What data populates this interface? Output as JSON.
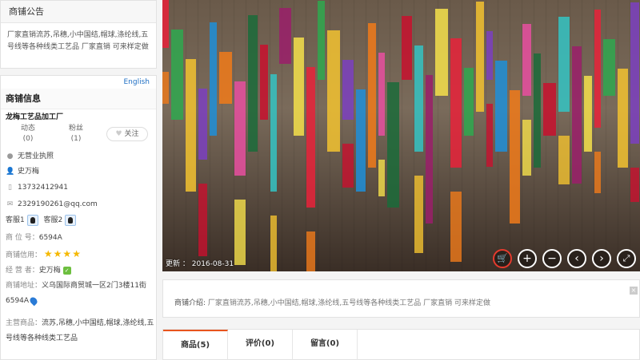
{
  "notice": {
    "title": "商铺公告",
    "text": "厂家直销流苏,吊穗,小中国结,帽球,涤纶线,五号线等各种线类工艺品 厂家直销 可来样定做"
  },
  "shop": {
    "english_link": "English",
    "title": "商铺信息",
    "name": "龙梅工艺品加工厂",
    "stats": {
      "dynamic_label": "动态",
      "dynamic_count": "(0)",
      "fans_label": "粉丝",
      "fans_count": "(1)"
    },
    "follow_label": "关注",
    "license": "无营业执照",
    "contact_name": "史万梅",
    "phone": "13732412941",
    "email": "2329190261@qq.com",
    "service1": "客服1",
    "service2": "客服2",
    "booth_label": "商 位 号：",
    "booth_value": "6594A",
    "credit_label": "商铺信用：",
    "credit_stars": 4,
    "operator_label": "经 营 者：",
    "operator_value": "史万梅",
    "address_label": "商铺地址：",
    "address_value": "义乌国际商贸城一区2门3楼11街6594A",
    "products_label": "主营商品：",
    "products_value": "流苏,吊穗,小中国结,帽球,涤纶线,五号线等各种线类工艺品"
  },
  "photo": {
    "update_label": "更新 ：",
    "update_date": "2016-08-31",
    "controls": [
      "cart-icon",
      "zoom-in-icon",
      "zoom-out-icon",
      "prev-icon",
      "next-icon",
      "fullscreen-icon"
    ]
  },
  "intro": {
    "label": "商铺介绍:",
    "text": "厂家直销流苏,吊穗,小中国结,帽球,涤纶线,五号线等各种线类工艺品 厂家直销 可来样定做"
  },
  "tabs": [
    {
      "label": "商品(5)"
    },
    {
      "label": "评价(0)"
    },
    {
      "label": "留言(0)"
    }
  ],
  "colors": {
    "accent": "#e8541e",
    "link": "#1f6fc4",
    "star": "#f5b800"
  }
}
